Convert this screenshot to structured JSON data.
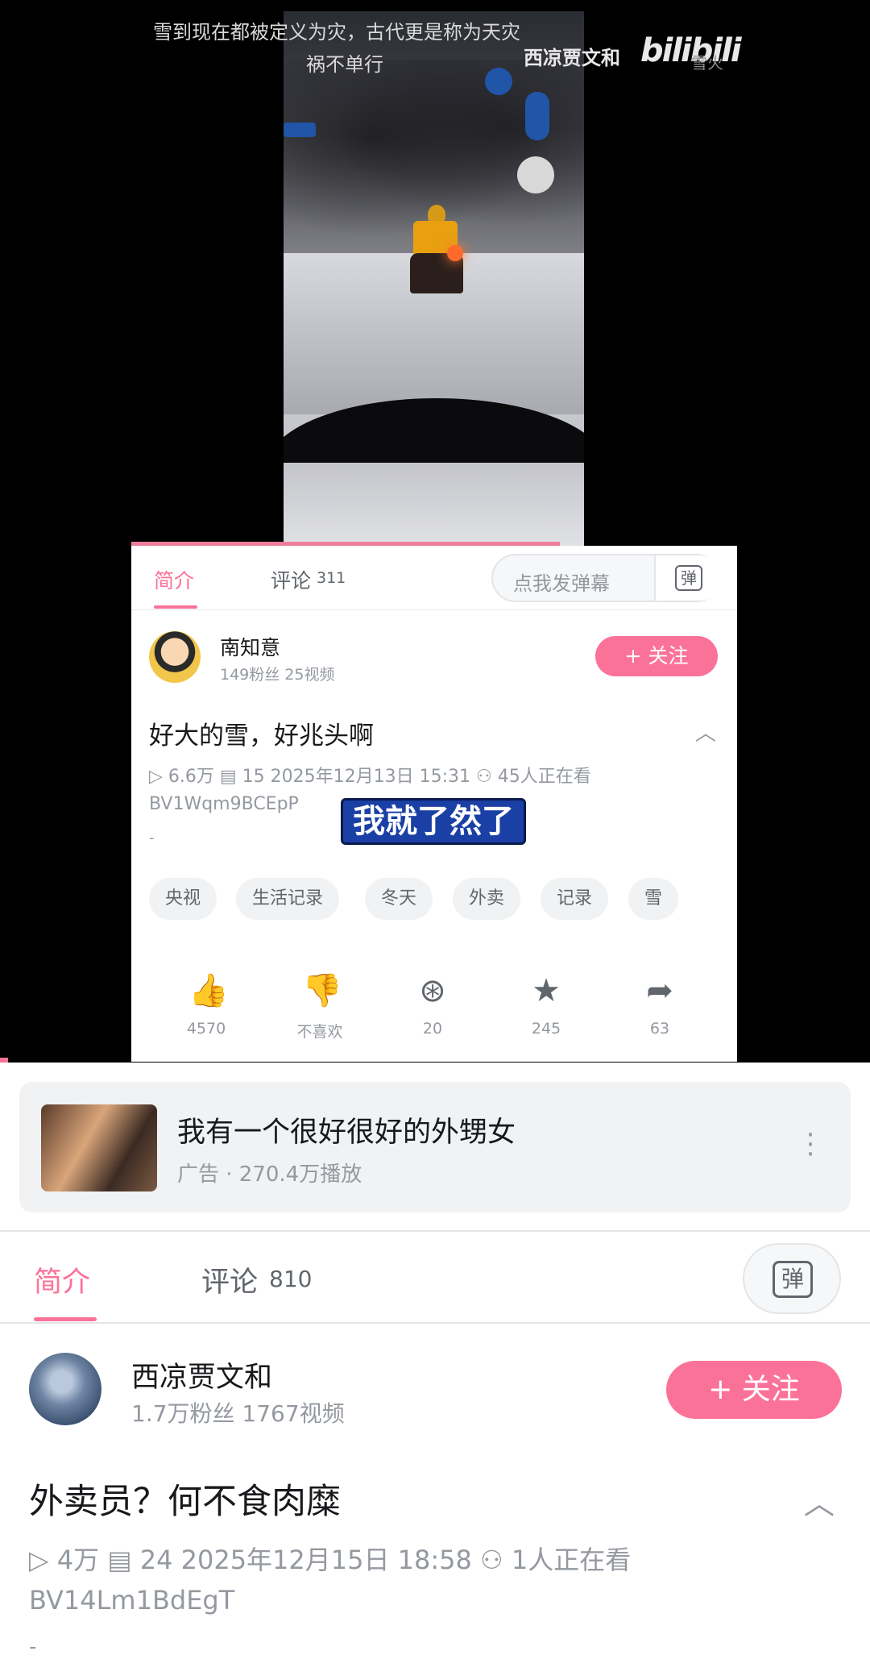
{
  "video": {
    "subtitle_line1": "雪到现在都被定义为灾，古代更是称为天灾",
    "subtitle_line2": "祸不单行",
    "watermark": "西凉贾文和",
    "logo": "bilibili",
    "logo_tail": "雪火"
  },
  "card1": {
    "tab_intro": "简介",
    "tab_comments": "评论",
    "comment_count": "311",
    "danmaku_placeholder": "点我发弹幕",
    "danmaku_icon_text": "弹",
    "author": "南知意",
    "author_meta": "149粉丝   25视频",
    "follow_label": "+ 关注",
    "title": "好大的雪，好兆头啊",
    "meta": "▷ 6.6万   ▤ 15   2025年12月13日 15:31   ⚇ 45人正在看",
    "bvid": "BV1Wqm9BCEpP",
    "dash": "-",
    "caption": "我就了然了",
    "tags": [
      "央视",
      "生活记录",
      "冬天",
      "外卖",
      "记录",
      "雪"
    ],
    "actions": [
      {
        "icon": "like-icon",
        "glyph": "👍",
        "label": "4570"
      },
      {
        "icon": "dislike-icon",
        "glyph": "👎",
        "label": "不喜欢"
      },
      {
        "icon": "coin-icon",
        "glyph": "⊛",
        "label": "20"
      },
      {
        "icon": "favorite-icon",
        "glyph": "★",
        "label": "245"
      },
      {
        "icon": "share-icon",
        "glyph": "➦",
        "label": "63"
      }
    ]
  },
  "ad": {
    "title": "我有一个很好很好的外甥女",
    "sub": "广告 · 270.4万播放"
  },
  "main": {
    "tab_intro": "简介",
    "tab_comments": "评论",
    "comment_count": "810",
    "danmaku_icon_text": "弹",
    "author": "西凉贾文和",
    "author_meta": "1.7万粉丝    1767视频",
    "follow_label": "+ 关注",
    "title": "外卖员？何不食肉糜",
    "meta": "▷ 4万   ▤ 24   2025年12月15日 18:58   ⚇ 1人正在看",
    "bvid": "BV14Lm1BdEgT",
    "dash": "-"
  },
  "colors": {
    "accent": "#fb7299",
    "muted": "#9499a0"
  }
}
